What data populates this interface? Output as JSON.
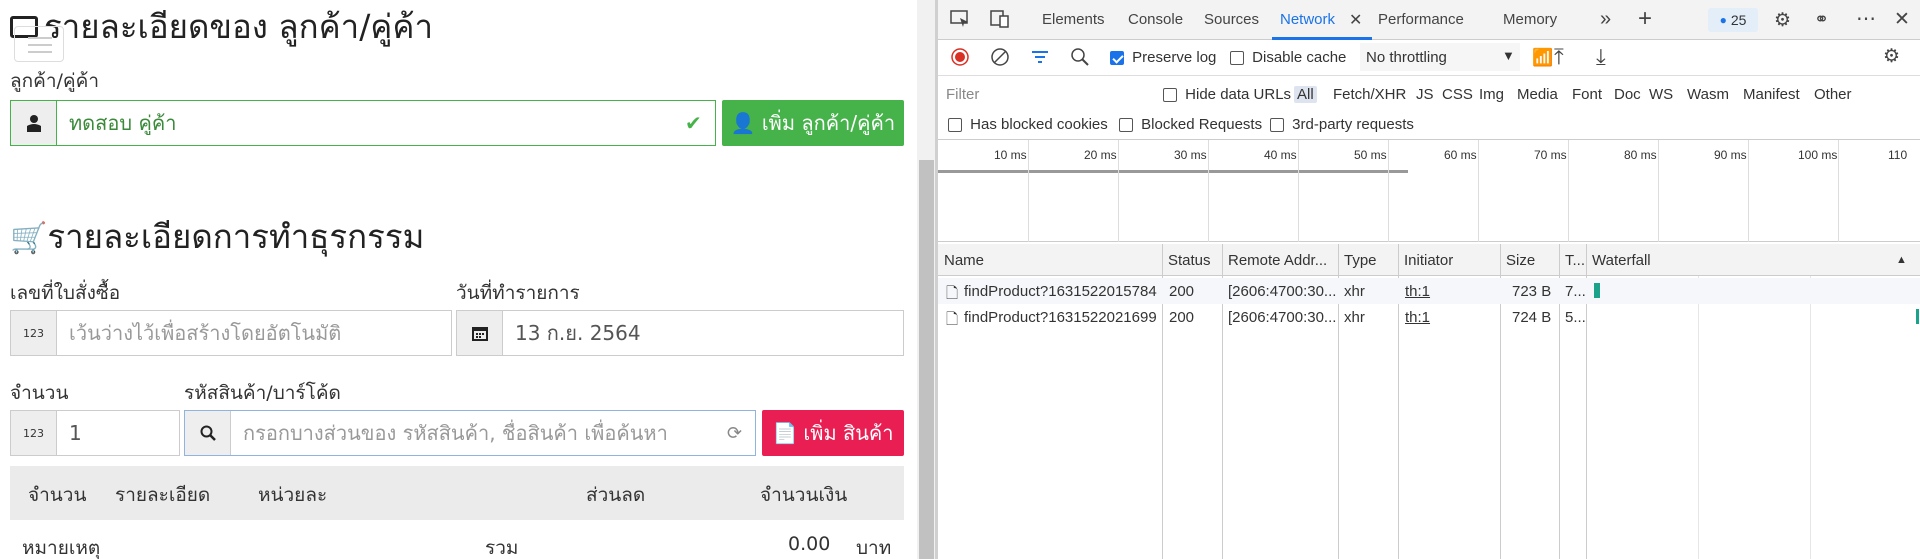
{
  "app": {
    "title": "รายละเอียดของ ลูกค้า/คู่ค้า",
    "customer_label": "ลูกค้า/คู่ค้า",
    "customer_value": "ทดสอบ คู่ค้า",
    "add_customer_btn": "เพิ่ม ลูกค้า/คู่ค้า",
    "section_title": "รายละเอียดการทำธุรกรรม",
    "po_label": "เลขที่ใบสั่งซื้อ",
    "po_placeholder": "เว้นว่างไว้เพื่อสร้างโดยอัตโนมัติ",
    "date_label": "วันที่ทำรายการ",
    "date_value": "13 ก.ย. 2564",
    "qty_label": "จำนวน",
    "qty_value": "1",
    "product_label": "รหัสสินค้า/บาร์โค้ด",
    "product_placeholder": "กรอกบางส่วนของ รหัสสินค้า, ชื่อสินค้า เพื่อค้นหา",
    "add_product_btn": "เพิ่ม สินค้า",
    "number_addon": "123",
    "table_headers": [
      "จำนวน",
      "รายละเอียด",
      "หน่วยละ",
      "ส่วนลด",
      "จำนวนเงิน"
    ],
    "footer": {
      "note_label": "หมายเหตุ",
      "total_label": "รวม",
      "total_value": "0.00",
      "currency": "บาท"
    },
    "colors": {
      "green": "#46b34a",
      "red": "#e91e53"
    }
  },
  "devtools": {
    "tabs": [
      "Elements",
      "Console",
      "Sources",
      "Network",
      "Performance",
      "Memory"
    ],
    "active_tab": "Network",
    "issues_count": "25",
    "toolbar": {
      "preserve_log": "Preserve log",
      "disable_cache": "Disable cache",
      "throttling": "No throttling"
    },
    "filter": {
      "placeholder": "Filter",
      "hide_data_urls": "Hide data URLs",
      "types": [
        "All",
        "Fetch/XHR",
        "JS",
        "CSS",
        "Img",
        "Media",
        "Font",
        "Doc",
        "WS",
        "Wasm",
        "Manifest",
        "Other"
      ],
      "has_blocked_cookies": "Has blocked cookies",
      "blocked_requests": "Blocked Requests",
      "third_party": "3rd-party requests"
    },
    "timeline_ticks": [
      "10 ms",
      "20 ms",
      "30 ms",
      "40 ms",
      "50 ms",
      "60 ms",
      "70 ms",
      "80 ms",
      "90 ms",
      "100 ms",
      "110"
    ],
    "columns": [
      "Name",
      "Status",
      "Remote Addr...",
      "Type",
      "Initiator",
      "Size",
      "T...",
      "Waterfall"
    ],
    "requests": [
      {
        "name": "findProduct?1631522015784",
        "status": "200",
        "remote": "[2606:4700:30...",
        "type": "xhr",
        "initiator": "th:1",
        "size": "723 B",
        "time": "7..."
      },
      {
        "name": "findProduct?1631522021699",
        "status": "200",
        "remote": "[2606:4700:30...",
        "type": "xhr",
        "initiator": "th:1",
        "size": "724 B",
        "time": "5..."
      }
    ]
  }
}
